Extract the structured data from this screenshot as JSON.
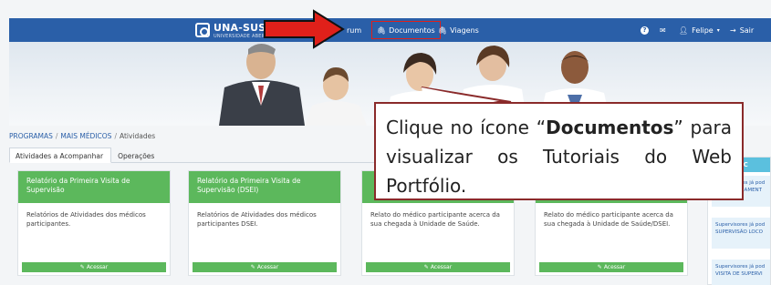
{
  "navbar": {
    "brand": "UNA-SUS",
    "brand_sub": "UNIVERSIDADE ABERTA DO SUS",
    "items": [
      {
        "label": "rum",
        "icon": "chat-icon"
      },
      {
        "label": "Documentos",
        "icon": "paperclip-icon"
      },
      {
        "label": "Viagens",
        "icon": "paperclip-icon"
      }
    ],
    "help_icon": "question-icon",
    "mail_icon": "envelope-icon",
    "user_label": "Felipe",
    "logout_label": "Sair",
    "colors": {
      "bar": "#2a5fa8",
      "highlight_border": "#e0201a"
    }
  },
  "breadcrumb": {
    "items": [
      "PROGRAMAS",
      "MAIS MÉDICOS",
      "Atividades"
    ],
    "separator": "/"
  },
  "tabs": [
    {
      "label": "Atividades a Acompanhar",
      "active": true
    },
    {
      "label": "Operações",
      "active": false
    }
  ],
  "cards": [
    {
      "title": "Relatório da Primeira Visita de Supervisão",
      "body": "Relatórios de Atividades dos médicos participantes.",
      "button": "Acessar"
    },
    {
      "title": "Relatório da Primeira Visita de Supervisão (DSEI)",
      "body": "Relatórios de Atividades dos médicos participantes DSEI.",
      "button": "Acessar"
    },
    {
      "title": "",
      "body": "Relato do médico participante acerca da sua chegada à Unidade de Saúde.",
      "button": "Acessar"
    },
    {
      "title": "",
      "body": "Relato do médico participante acerca da sua chegada à Unidade de Saúde/DSEI.",
      "button": "Acessar"
    }
  ],
  "notifications": {
    "title": "NOTIFIC",
    "items": [
      "Supervisores já pod ACOMPANHAMENT",
      "Supervisores já pod SUPERVISÃO LOCO",
      "Supervisores já pod VISITA DE SUPERVI"
    ]
  },
  "callout": {
    "text_before": "Clique no ícone “",
    "bold": "Documentos",
    "text_after": "” para visualizar os Tutoriais do Web Portfólio.",
    "border_color": "#8a2a2a"
  },
  "arrow_color": "#e0201a",
  "accent_green": "#5cb85c"
}
